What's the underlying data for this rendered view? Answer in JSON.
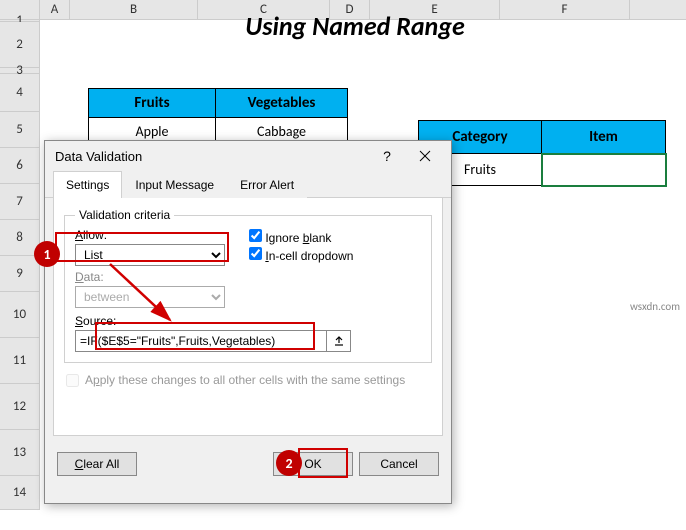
{
  "sheet": {
    "title": "Using Named Range",
    "columns": [
      "A",
      "B",
      "C",
      "D",
      "E",
      "F"
    ],
    "rows": [
      "1",
      "2",
      "3",
      "4",
      "5",
      "6",
      "7",
      "8",
      "9",
      "10",
      "11",
      "12",
      "13",
      "14"
    ]
  },
  "table1": {
    "headers": [
      "Fruits",
      "Vegetables"
    ],
    "row1": [
      "Apple",
      "Cabbage"
    ]
  },
  "table2": {
    "headers": [
      "Category",
      "Item"
    ],
    "values": [
      "Fruits",
      ""
    ]
  },
  "dialog": {
    "title": "Data Validation",
    "tabs": [
      "Settings",
      "Input Message",
      "Error Alert"
    ],
    "legend": "Validation criteria",
    "allow_label": "Allow:",
    "allow_value": "List",
    "data_label": "Data:",
    "data_value": "between",
    "ignore_blank": "Ignore blank",
    "incell_dropdown": "In-cell dropdown",
    "source_label": "Source:",
    "source_value": "=IF($E$5=\"Fruits\",Fruits,Vegetables)",
    "apply_label": "Apply these changes to all other cells with the same settings",
    "clear_btn": "Clear All",
    "ok_btn": "OK",
    "cancel_btn": "Cancel"
  },
  "annotations": {
    "step1": "1",
    "step2": "2"
  },
  "watermark": "wsxdn.com"
}
